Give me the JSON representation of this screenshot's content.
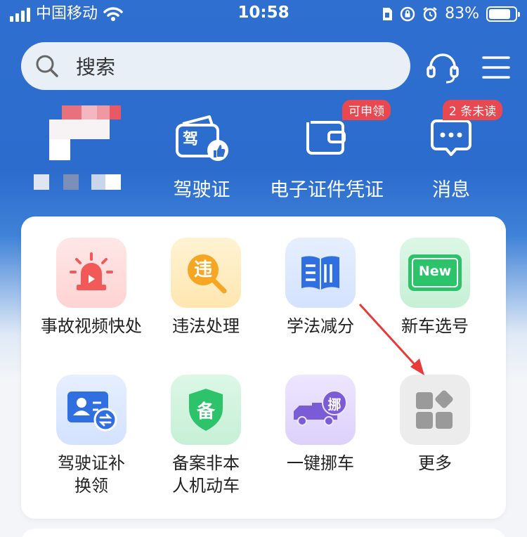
{
  "status_bar": {
    "carrier": "中国移动",
    "time": "10:58",
    "battery": "83%",
    "battery_level": 0.83,
    "icons": [
      "signal-icon",
      "wifi-icon",
      "sim-icon",
      "rotation-lock-icon",
      "alarm-icon",
      "battery-icon"
    ]
  },
  "header": {
    "search_placeholder": "搜索",
    "icons": [
      "search-icon",
      "headset-icon",
      "menu-icon"
    ]
  },
  "top_row": {
    "items": [
      {
        "label": "驾驶证",
        "icon": "driver-license-icon",
        "icon_text": "驾",
        "badge": ""
      },
      {
        "label": "电子证件凭证",
        "icon": "wallet-icon",
        "badge": "可申领"
      },
      {
        "label": "消息",
        "icon": "message-icon",
        "badge": "2 条未读"
      }
    ]
  },
  "services": {
    "items": [
      {
        "label": "事故视频快处",
        "icon": "alarm-light-icon",
        "color": "#f25a5a"
      },
      {
        "label": "违法处理",
        "icon": "violation-icon",
        "icon_text": "违",
        "color": "#f5a623"
      },
      {
        "label": "学法减分",
        "icon": "book-icon",
        "color": "#2f6fe0"
      },
      {
        "label": "新车选号",
        "icon": "new-plate-icon",
        "icon_text": "New",
        "color": "#2cc36b"
      },
      {
        "label": "驾驶证补换领",
        "icon": "license-swap-icon",
        "color": "#2f6fe0"
      },
      {
        "label": "备案非本人机动车",
        "icon": "shield-icon",
        "icon_text": "备",
        "color": "#2cc36b"
      },
      {
        "label": "一键挪车",
        "icon": "truck-icon",
        "icon_text": "挪",
        "color": "#7b5cd6"
      },
      {
        "label": "更多",
        "icon": "more-apps-icon",
        "color": "#9a9a9a"
      }
    ]
  },
  "colors": {
    "primary": "#2e6fd0",
    "badge": "#e8484f",
    "annotation_arrow": "#e83a3a"
  }
}
